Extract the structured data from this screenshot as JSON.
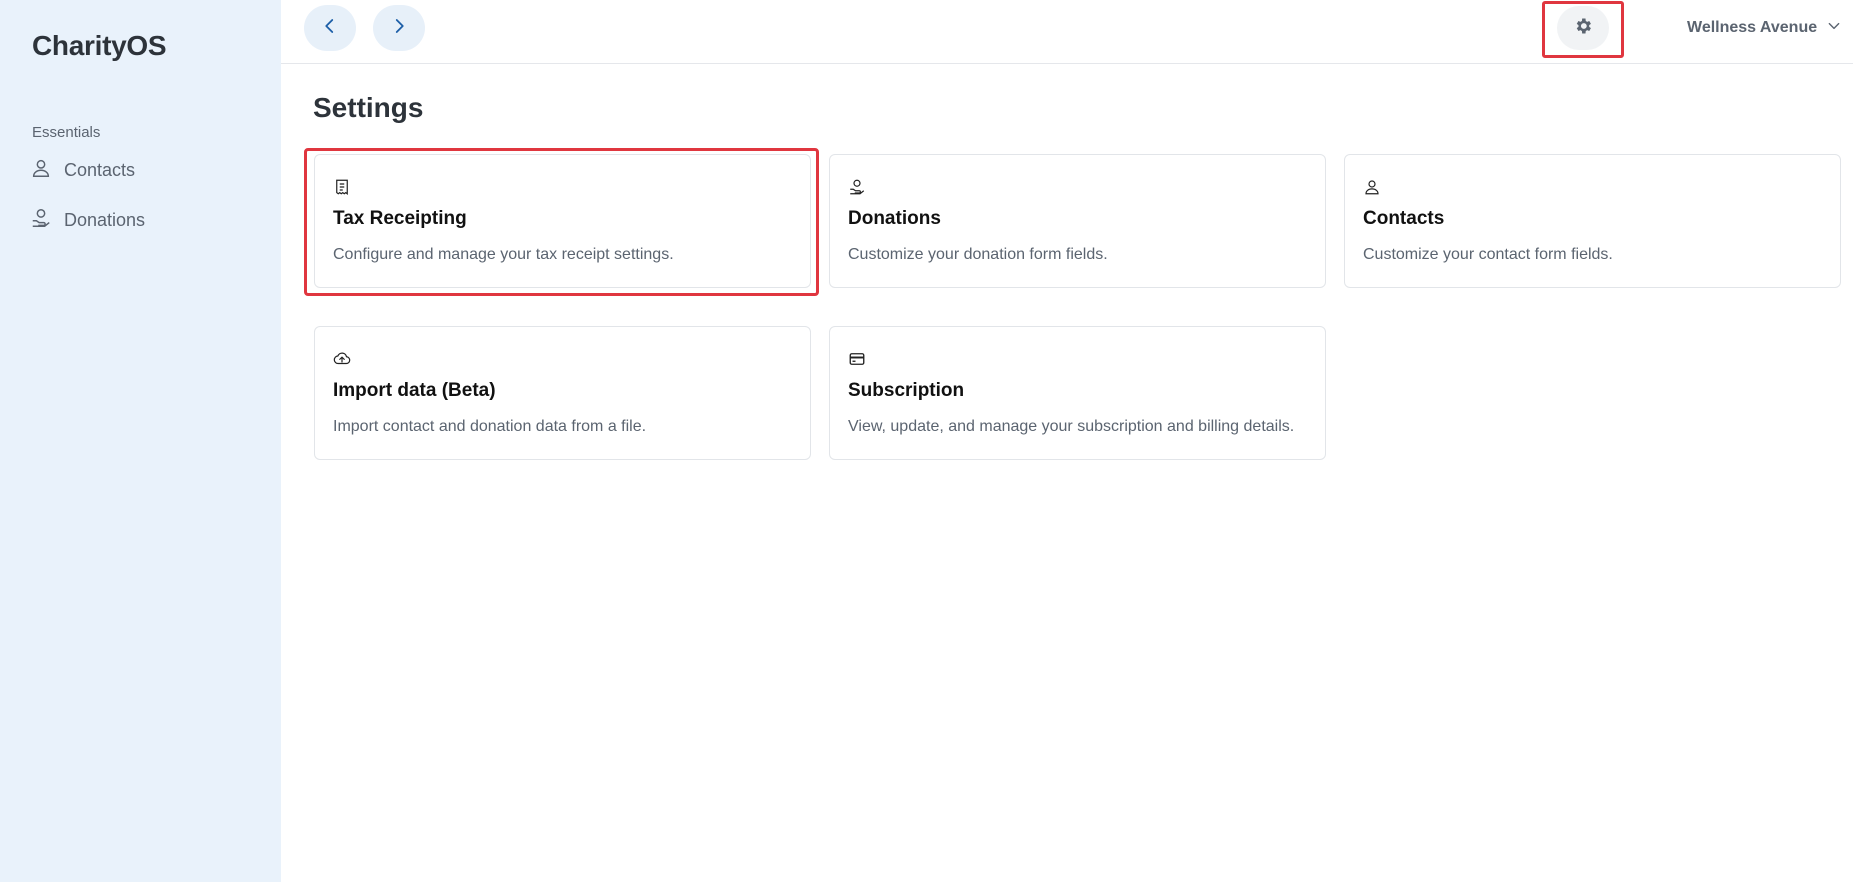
{
  "sidebar": {
    "brand": "CharityOS",
    "section_label": "Essentials",
    "items": [
      {
        "label": "Contacts",
        "icon": "person-icon"
      },
      {
        "label": "Donations",
        "icon": "hand-coin-icon"
      }
    ]
  },
  "topbar": {
    "back_icon": "chevron-left-icon",
    "forward_icon": "chevron-right-icon",
    "settings_icon": "gear-icon",
    "org_name": "Wellness Avenue"
  },
  "main": {
    "title": "Settings",
    "cards": [
      {
        "title": "Tax Receipting",
        "description": "Configure and manage your tax receipt settings.",
        "icon": "receipt-icon"
      },
      {
        "title": "Donations",
        "description": "Customize your donation form fields.",
        "icon": "hand-coin-icon"
      },
      {
        "title": "Contacts",
        "description": "Customize your contact form fields.",
        "icon": "person-icon"
      },
      {
        "title": "Import data (Beta)",
        "description": "Import contact and donation data from a file.",
        "icon": "cloud-upload-icon"
      },
      {
        "title": "Subscription",
        "description": "View, update, and manage your subscription and billing details.",
        "icon": "credit-card-icon"
      }
    ]
  },
  "colors": {
    "sidebar_bg": "#e9f2fb",
    "highlight": "#e0363f",
    "nav_button_bg": "#e7f0f9",
    "icon_blue": "#1d5fa8"
  }
}
